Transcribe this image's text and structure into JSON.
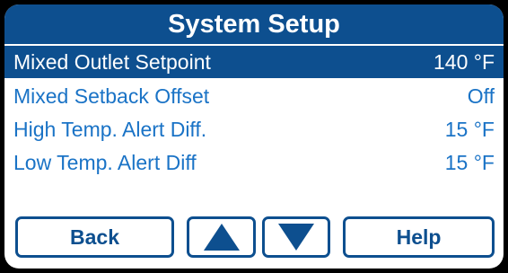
{
  "header": {
    "title": "System Setup"
  },
  "settings": [
    {
      "label": "Mixed Outlet Setpoint",
      "value": "140 °F",
      "selected": true
    },
    {
      "label": "Mixed Setback Offset",
      "value": "Off",
      "selected": false
    },
    {
      "label": "High Temp. Alert Diff.",
      "value": "15 °F",
      "selected": false
    },
    {
      "label": "Low Temp. Alert Diff",
      "value": "15 °F",
      "selected": false
    }
  ],
  "buttons": {
    "back": "Back",
    "up_icon": "up-arrow-icon",
    "down_icon": "down-arrow-icon",
    "help": "Help"
  },
  "colors": {
    "accent": "#0d4f8f",
    "text": "#1a73c6",
    "background": "#ffffff",
    "bezel": "#000000"
  }
}
